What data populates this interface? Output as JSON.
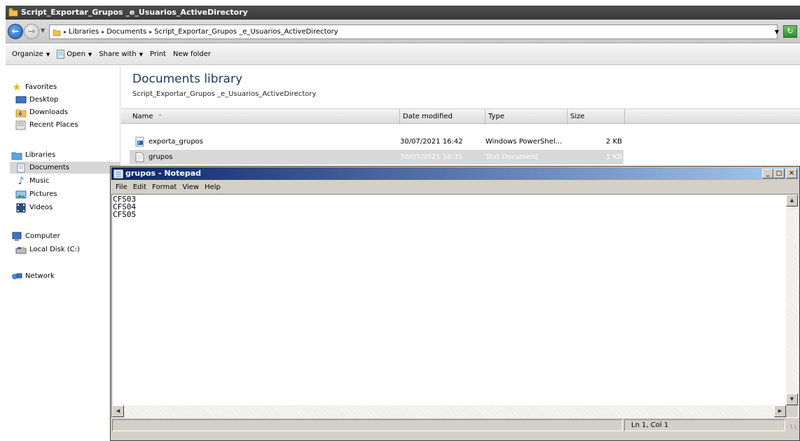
{
  "explorer": {
    "title": "Script_Exportar_Grupos _e_Usuarios_ActiveDirectory",
    "breadcrumb": [
      "Libraries",
      "Documents",
      "Script_Exportar_Grupos _e_Usuarios_ActiveDirectory"
    ],
    "toolbar": {
      "organize": "Organize",
      "open": "Open",
      "share_with": "Share with",
      "print": "Print",
      "new_folder": "New folder"
    },
    "nav": {
      "favorites": "Favorites",
      "desktop": "Desktop",
      "downloads": "Downloads",
      "recent_places": "Recent Places",
      "libraries": "Libraries",
      "documents": "Documents",
      "music": "Music",
      "pictures": "Pictures",
      "videos": "Videos",
      "computer": "Computer",
      "local_disk": "Local Disk (C:)",
      "network": "Network"
    },
    "library": {
      "title": "Documents library",
      "subtitle": "Script_Exportar_Grupos _e_Usuarios_ActiveDirectory"
    },
    "columns": {
      "name": "Name",
      "date_modified": "Date modified",
      "type": "Type",
      "size": "Size"
    },
    "files": [
      {
        "name": "exporta_grupos",
        "date": "30/07/2021 16:42",
        "type": "Windows PowerShel...",
        "size": "2 KB",
        "icon": "powershell-script-icon"
      },
      {
        "name": "grupos",
        "date": "30/07/2021 16:31",
        "type": "Text Document",
        "size": "1 KB",
        "icon": "text-document-icon"
      }
    ]
  },
  "notepad": {
    "title": "grupos - Notepad",
    "menu": {
      "file": "File",
      "edit": "Edit",
      "format": "Format",
      "view": "View",
      "help": "Help"
    },
    "content": "CFS03\nCFS04\nCFS05",
    "status_position": "Ln 1, Col 1"
  },
  "colors": {
    "notepad_title_start": "#0b246a",
    "notepad_title_end": "#a6caf0",
    "library_title": "#1e395b"
  }
}
